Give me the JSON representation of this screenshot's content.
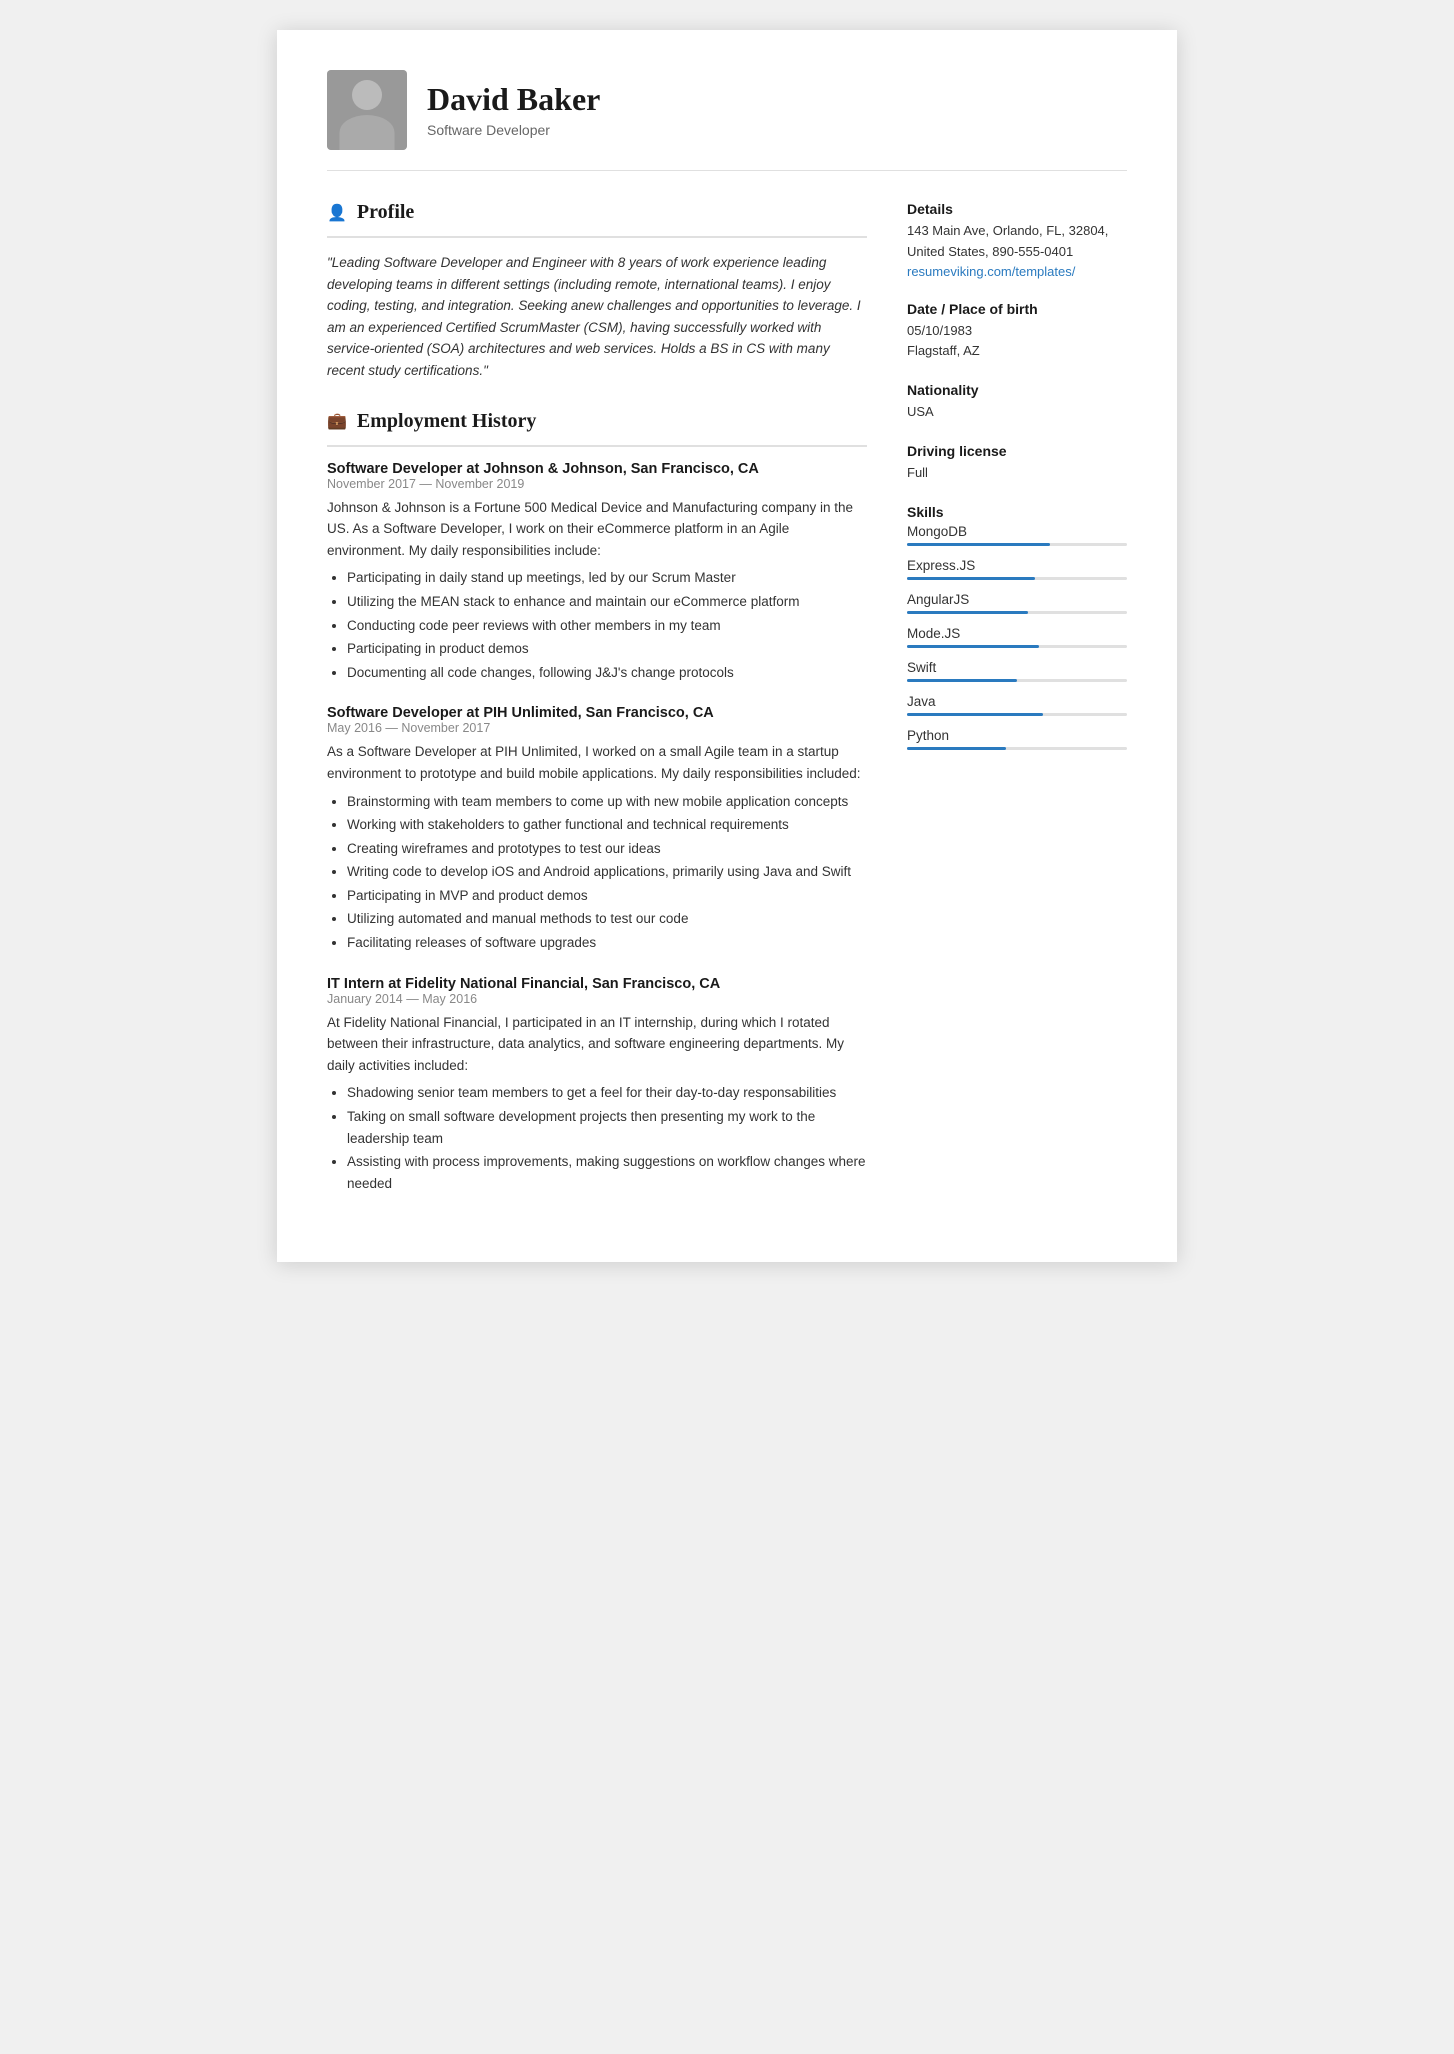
{
  "header": {
    "name": "David Baker",
    "title": "Software Developer"
  },
  "profile": {
    "section_title": "Profile",
    "text": "\"Leading Software Developer and Engineer with 8 years of work experience leading developing teams in different settings (including remote, international teams). I enjoy coding, testing, and integration. Seeking anew challenges and opportunities to leverage. I am an experienced Certified ScrumMaster (CSM), having successfully worked with service-oriented (SOA) architectures and web services. Holds a BS in CS with many recent study certifications.\""
  },
  "employment": {
    "section_title": "Employment History",
    "jobs": [
      {
        "title": "Software Developer at",
        "company": " Johnson & Johnson, San Francisco, CA",
        "dates": "November 2017 — November 2019",
        "description": "Johnson & Johnson is a Fortune 500 Medical Device and Manufacturing company in the US. As a Software Developer, I work on their eCommerce platform in an Agile environment. My daily responsibilities include:",
        "bullets": [
          "Participating in daily stand up meetings, led by our Scrum Master",
          "Utilizing the MEAN stack to enhance and maintain our eCommerce platform",
          "Conducting code peer reviews with other members in my team",
          "Participating in product demos",
          "Documenting all code changes, following J&J's change protocols"
        ]
      },
      {
        "title": "Software Developer at",
        "company": " PIH Unlimited, San Francisco, CA",
        "dates": "May 2016 — November 2017",
        "description": "As a Software Developer at PIH Unlimited, I worked on a small Agile team in a startup environment to prototype and build mobile applications. My daily responsibilities included:",
        "bullets": [
          "Brainstorming with team members to come up with new mobile application concepts",
          "Working with stakeholders to gather functional and technical requirements",
          "Creating wireframes and prototypes to test our ideas",
          "Writing code to develop iOS and Android applications, primarily using Java and Swift",
          "Participating in MVP and product demos",
          "Utilizing automated and manual methods to test our code",
          "Facilitating releases of software upgrades"
        ]
      },
      {
        "title": "IT Intern at",
        "company": " Fidelity National Financial, San Francisco, CA",
        "dates": "January 2014 — May 2016",
        "description": "At Fidelity National Financial, I participated in an IT internship, during which I rotated between their infrastructure, data analytics, and software engineering departments. My daily activities included:",
        "bullets": [
          "Shadowing senior team members to get a feel for their day-to-day responsabilities",
          "Taking on small software development projects then presenting my work to the leadership team",
          "Assisting with process improvements, making suggestions on workflow changes where needed"
        ]
      }
    ]
  },
  "details": {
    "section_title": "Details",
    "address": "143 Main Ave, Orlando, FL, 32804,",
    "address2": "United States, 890-555-0401",
    "website": "resumeviking.com/templates/",
    "dob_label": "Date / Place of birth",
    "dob": "05/10/1983",
    "place_of_birth": "Flagstaff, AZ",
    "nationality_label": "Nationality",
    "nationality": "USA",
    "driving_label": "Driving license",
    "driving": "Full"
  },
  "skills": {
    "section_title": "Skills",
    "items": [
      {
        "name": "MongoDB",
        "level": 65
      },
      {
        "name": "Express.JS",
        "level": 58
      },
      {
        "name": "AngularJS",
        "level": 55
      },
      {
        "name": "Mode.JS",
        "level": 60
      },
      {
        "name": "Swift",
        "level": 50
      },
      {
        "name": "Java",
        "level": 62
      },
      {
        "name": "Python",
        "level": 45
      }
    ]
  }
}
